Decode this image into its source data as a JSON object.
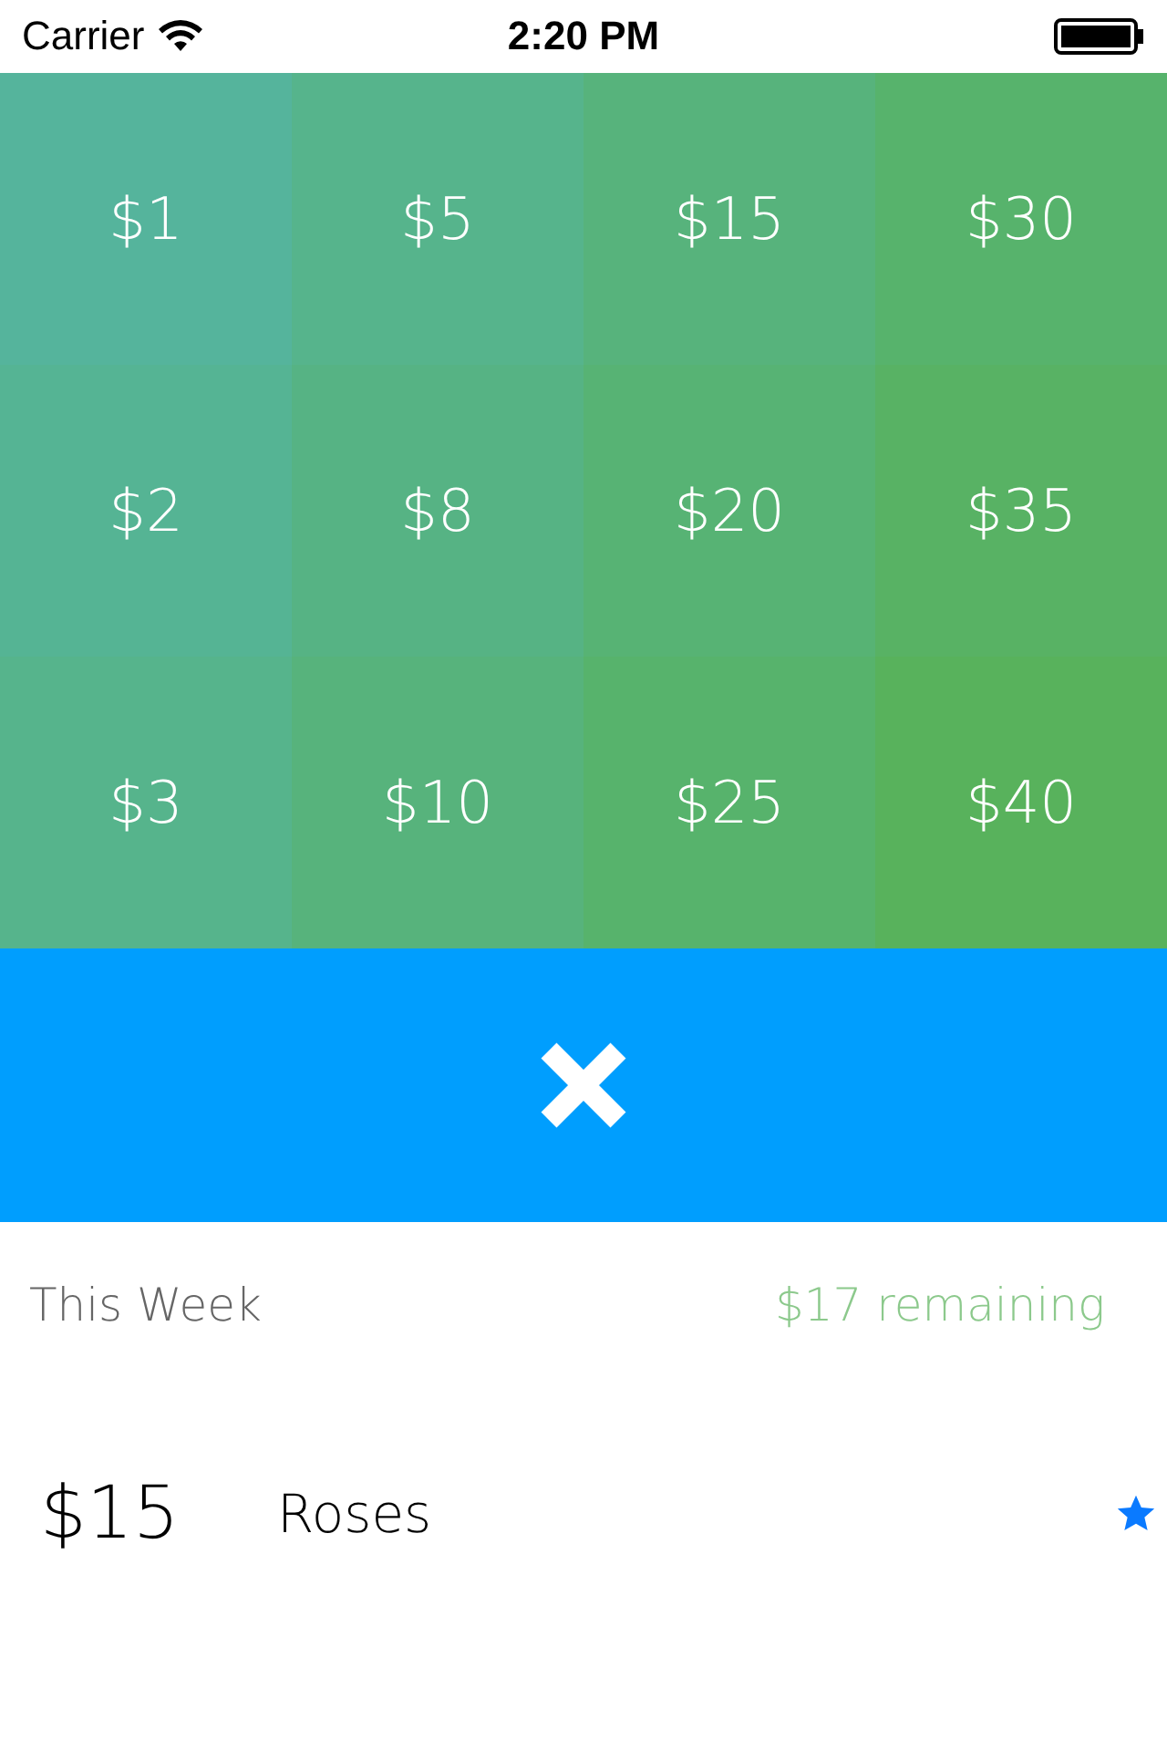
{
  "status_bar": {
    "carrier": "Carrier",
    "time": "2:20 PM"
  },
  "amounts": [
    [
      "$1",
      "$5",
      "$15",
      "$30"
    ],
    [
      "$2",
      "$8",
      "$20",
      "$35"
    ],
    [
      "$3",
      "$10",
      "$25",
      "$40"
    ]
  ],
  "summary": {
    "period": "This Week",
    "remaining": "$17 remaining"
  },
  "entries": [
    {
      "amount": "$15",
      "name": "Roses",
      "starred": true
    }
  ]
}
